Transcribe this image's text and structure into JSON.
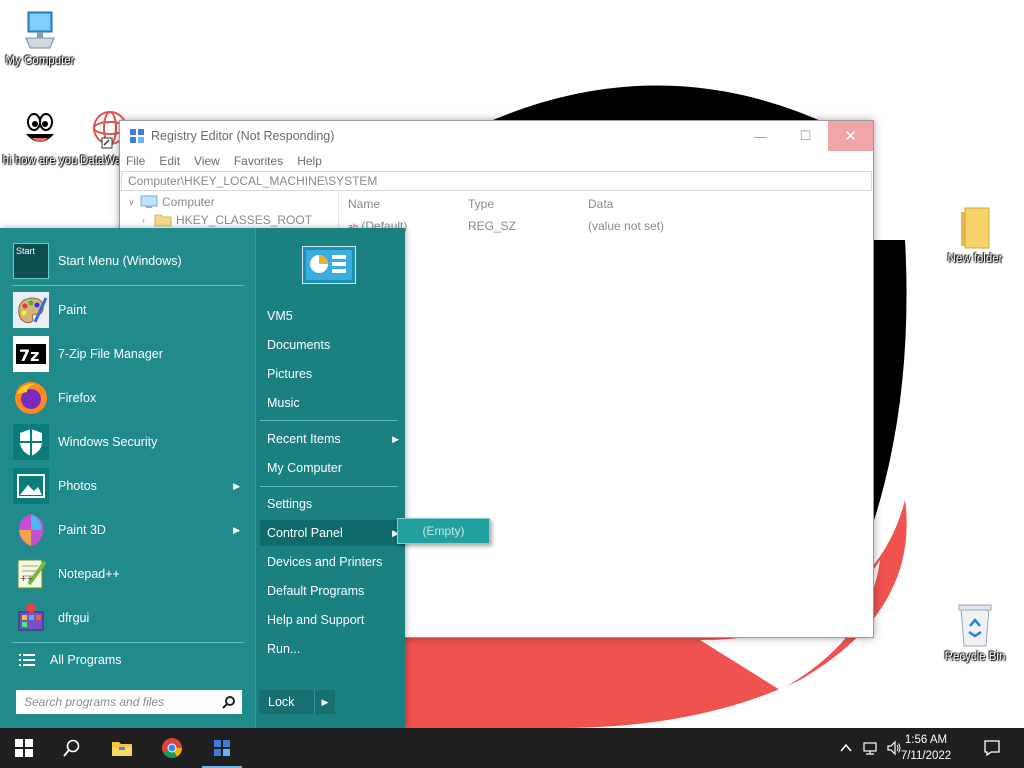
{
  "desktop": {
    "icons": [
      {
        "id": "my-computer",
        "label": "My Computer",
        "icon": "computer-icon"
      },
      {
        "id": "hi",
        "label": "hi how are you",
        "icon": "smiley-face-icon"
      },
      {
        "id": "datawa",
        "label": "DataWa",
        "icon": "datawa-icon"
      },
      {
        "id": "new-folder",
        "label": "New folder",
        "icon": "folder-icon"
      },
      {
        "id": "recycle-bin",
        "label": "Recycle Bin",
        "icon": "recycle-bin-icon"
      }
    ]
  },
  "regedit": {
    "title": "Registry Editor (Not Responding)",
    "menu": [
      "File",
      "Edit",
      "View",
      "Favorites",
      "Help"
    ],
    "address": "Computer\\HKEY_LOCAL_MACHINE\\SYSTEM",
    "tree": [
      "Computer",
      "HKEY_CLASSES_ROOT"
    ],
    "columns": {
      "name": "Name",
      "type": "Type",
      "data": "Data"
    },
    "rows": [
      {
        "name": "(Default)",
        "type": "REG_SZ",
        "data": "(value not set)"
      }
    ],
    "controls": {
      "minimize": "—",
      "maximize": "☐",
      "close": "✕"
    }
  },
  "start_menu": {
    "header_tile": "Start",
    "programs": [
      {
        "label": "Start Menu (Windows)",
        "icon": "start-menu-tile-icon",
        "arrow": false
      },
      {
        "label": "Paint",
        "icon": "paint-palette-icon",
        "arrow": false
      },
      {
        "label": "7-Zip File Manager",
        "icon": "7zip-icon",
        "arrow": false
      },
      {
        "label": "Firefox",
        "icon": "firefox-icon",
        "arrow": false
      },
      {
        "label": "Windows Security",
        "icon": "shield-icon",
        "arrow": false
      },
      {
        "label": "Photos",
        "icon": "photos-icon",
        "arrow": true
      },
      {
        "label": "Paint 3D",
        "icon": "paint-3d-icon",
        "arrow": true
      },
      {
        "label": "Notepad++",
        "icon": "notepad-plus-plus-icon",
        "arrow": false
      },
      {
        "label": "dfrgui",
        "icon": "defrag-icon",
        "arrow": false
      }
    ],
    "all_programs": "All Programs",
    "search_placeholder": "Search programs and files",
    "right_links": [
      {
        "label": "VM5",
        "arrow": false
      },
      {
        "label": "Documents",
        "arrow": false
      },
      {
        "label": "Pictures",
        "arrow": false
      },
      {
        "label": "Music",
        "arrow": false
      },
      {
        "label": "Recent Items",
        "arrow": true
      },
      {
        "label": "My Computer",
        "arrow": false
      },
      {
        "label": "Settings",
        "arrow": false
      },
      {
        "label": "Control Panel",
        "arrow": true
      },
      {
        "label": "Devices and Printers",
        "arrow": false
      },
      {
        "label": "Default Programs",
        "arrow": false
      },
      {
        "label": "Help and Support",
        "arrow": false
      },
      {
        "label": "Run...",
        "arrow": false
      }
    ],
    "lock": "Lock",
    "submenu_empty": "(Empty)"
  },
  "taskbar": {
    "time": "1:56 AM",
    "date": "7/11/2022",
    "apps": [
      "windows-start-icon",
      "search-icon",
      "file-explorer-icon",
      "chrome-icon",
      "registry-editor-icon"
    ]
  },
  "colors": {
    "start_bg": "#218b8b",
    "start_right": "#1a8080",
    "taskbar": "#1f1f1f",
    "close_btn": "#f1a5a8"
  }
}
